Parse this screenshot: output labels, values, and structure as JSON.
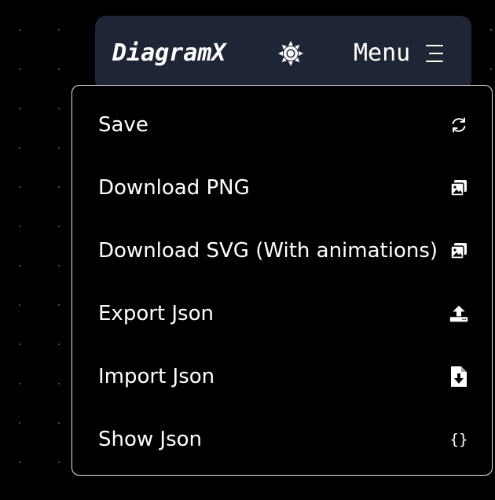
{
  "header": {
    "logo": "DiagramX",
    "theme_icon": "sun-icon",
    "menu_label": "Menu",
    "menu_icon": "hamburger-icon"
  },
  "menu": {
    "items": [
      {
        "label": "Save",
        "icon": "sync-icon"
      },
      {
        "label": "Download PNG",
        "icon": "images-icon"
      },
      {
        "label": "Download SVG (With animations)",
        "icon": "images-icon"
      },
      {
        "label": "Export Json",
        "icon": "upload-icon"
      },
      {
        "label": "Import Json",
        "icon": "file-import-icon"
      },
      {
        "label": "Show Json",
        "icon": "braces-icon",
        "icon_text": "{}"
      }
    ]
  },
  "colors": {
    "background": "#000000",
    "header_bg": "#1e2636",
    "text": "#ffffff",
    "dropdown_border": "#e6e6e6",
    "grid_dot": "#555555"
  }
}
